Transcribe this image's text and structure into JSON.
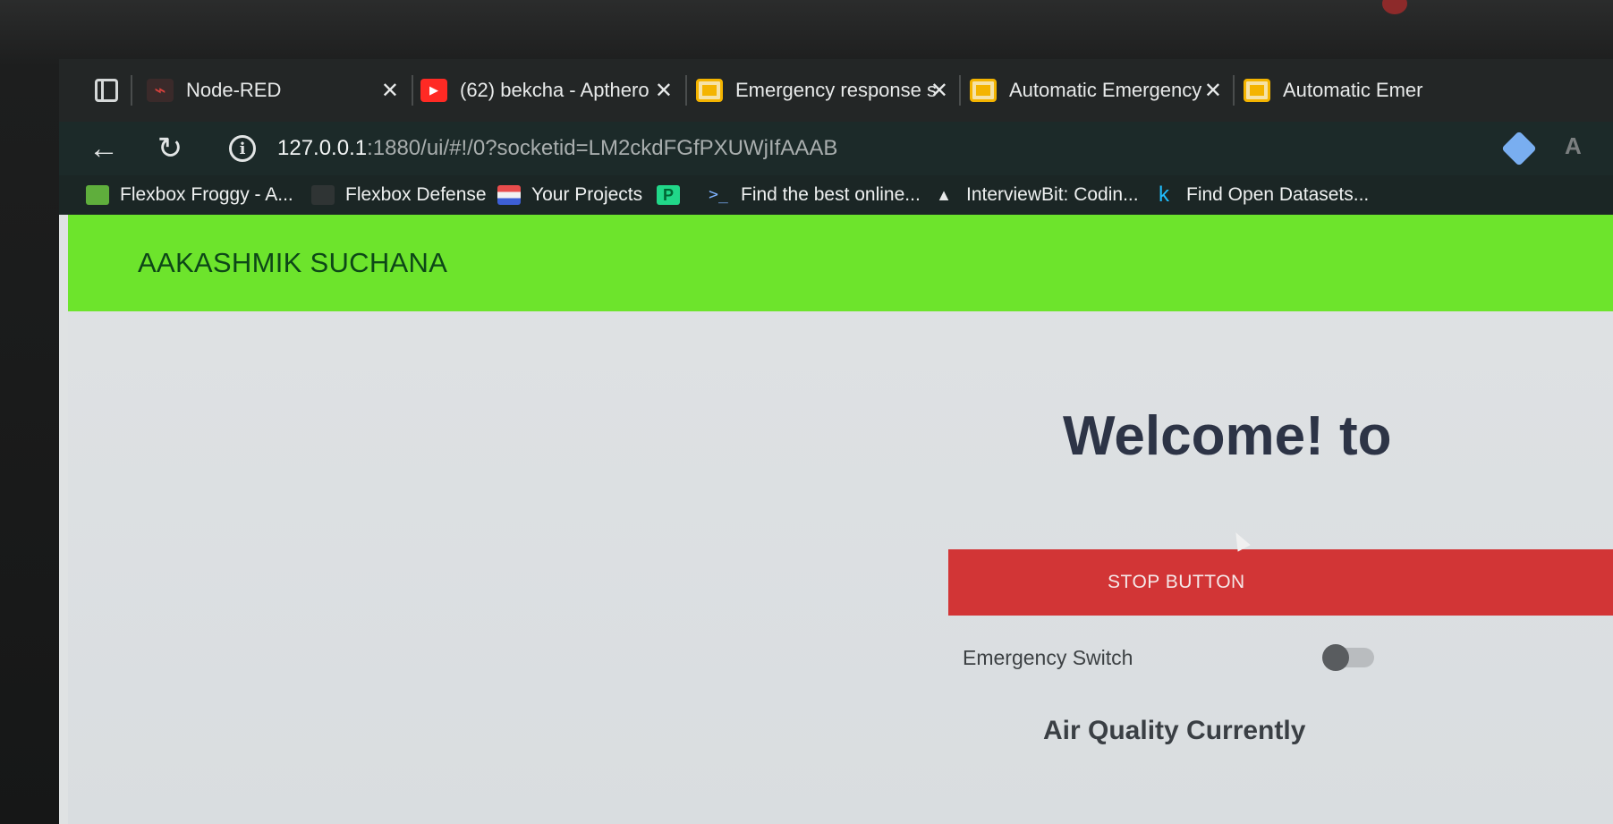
{
  "browser": {
    "tabs": [
      {
        "title": "Node-RED",
        "icon": "node-red-icon",
        "color": "#d9413c"
      },
      {
        "title": "(62) bekcha - Apthero",
        "icon": "youtube-icon",
        "color": "#ff2a24"
      },
      {
        "title": "Emergency response s",
        "icon": "slides-icon",
        "color": "#f4b400"
      },
      {
        "title": "Automatic Emergency",
        "icon": "slides-icon",
        "color": "#f4b400"
      },
      {
        "title": "Automatic Emer",
        "icon": "slides-icon",
        "color": "#f4b400"
      }
    ],
    "close_glyph": "✕",
    "url_host": "127.0.0.1",
    "url_rest": ":1880/ui/#!/0?socketid=LM2ckdFGfPXUWjIfAAAB",
    "bookmarks": [
      {
        "label": "Flexbox Froggy - A...",
        "icon": "froggy-icon"
      },
      {
        "label": "Flexbox Defense",
        "icon": "defense-icon"
      },
      {
        "label": "Your Projects",
        "icon": "projects-icon"
      },
      {
        "label": "",
        "icon": "pycharm-icon"
      },
      {
        "label": "Find the best online...",
        "icon": "terminal-icon"
      },
      {
        "label": "InterviewBit: Codin...",
        "icon": "interviewbit-icon"
      },
      {
        "label": "Find Open Datasets...",
        "icon": "kaggle-icon"
      }
    ]
  },
  "app": {
    "title": "AAKASHMIK SUCHANA",
    "header_color": "#6de42c",
    "welcome": "Welcome! to",
    "stop_button": "STOP BUTTON",
    "stop_button_color": "#d23536",
    "emergency_switch_label": "Emergency Switch",
    "emergency_switch_on": false,
    "air_quality_label": "Air Quality Currently"
  }
}
